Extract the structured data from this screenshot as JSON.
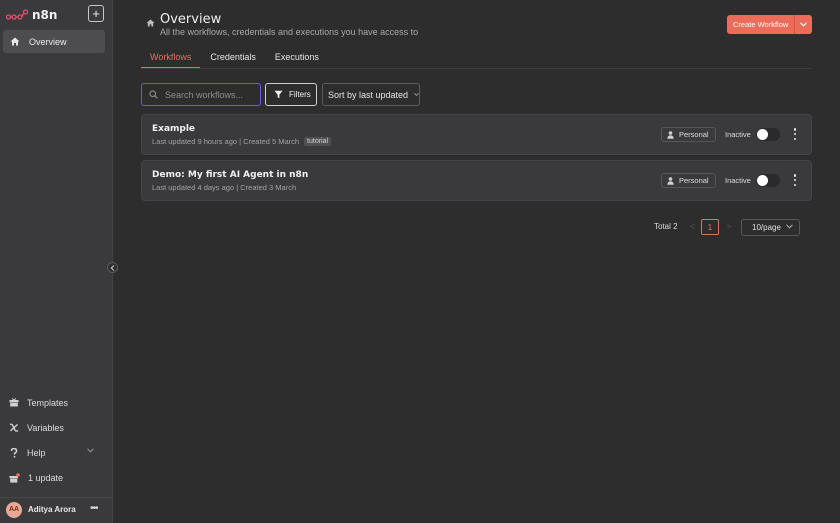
{
  "app": {
    "brand": "n8n",
    "accent": "#ec6c59",
    "focus_color": "#6b5be0"
  },
  "sidebar": {
    "add_label": "+",
    "overview_label": "Overview",
    "bottom_items": [
      {
        "label": "Templates",
        "icon": "box-icon"
      },
      {
        "label": "Variables",
        "icon": "variable-icon"
      },
      {
        "label": "Help",
        "icon": "question-icon"
      },
      {
        "label": "1 update",
        "icon": "gift-icon"
      }
    ],
    "user": {
      "initials": "AA",
      "name": "Aditya Arora",
      "menu": "•••"
    }
  },
  "header": {
    "title": "Overview",
    "subtitle": "All the workflows, credentials and executions you have access to",
    "create_label": "Create Workflow"
  },
  "tabs": [
    {
      "label": "Workflows",
      "active": true
    },
    {
      "label": "Credentials",
      "active": false
    },
    {
      "label": "Executions",
      "active": false
    }
  ],
  "toolbar": {
    "search_placeholder": "Search workflows...",
    "filters_label": "Filters",
    "sort_label": "Sort by last updated"
  },
  "workflows": [
    {
      "name": "Example",
      "meta": "Last updated 9 hours ago | Created 5 March",
      "tag": "tutorial",
      "owner": "Personal",
      "status": "Inactive",
      "active": false
    },
    {
      "name": "Demo: My first AI Agent in n8n",
      "meta": "Last updated 4 days ago | Created 3 March",
      "tag": "",
      "owner": "Personal",
      "status": "Inactive",
      "active": false
    }
  ],
  "pagination": {
    "total": "Total 2",
    "prev": "<",
    "current": "1",
    "next": ">",
    "per_page": "10/page"
  }
}
